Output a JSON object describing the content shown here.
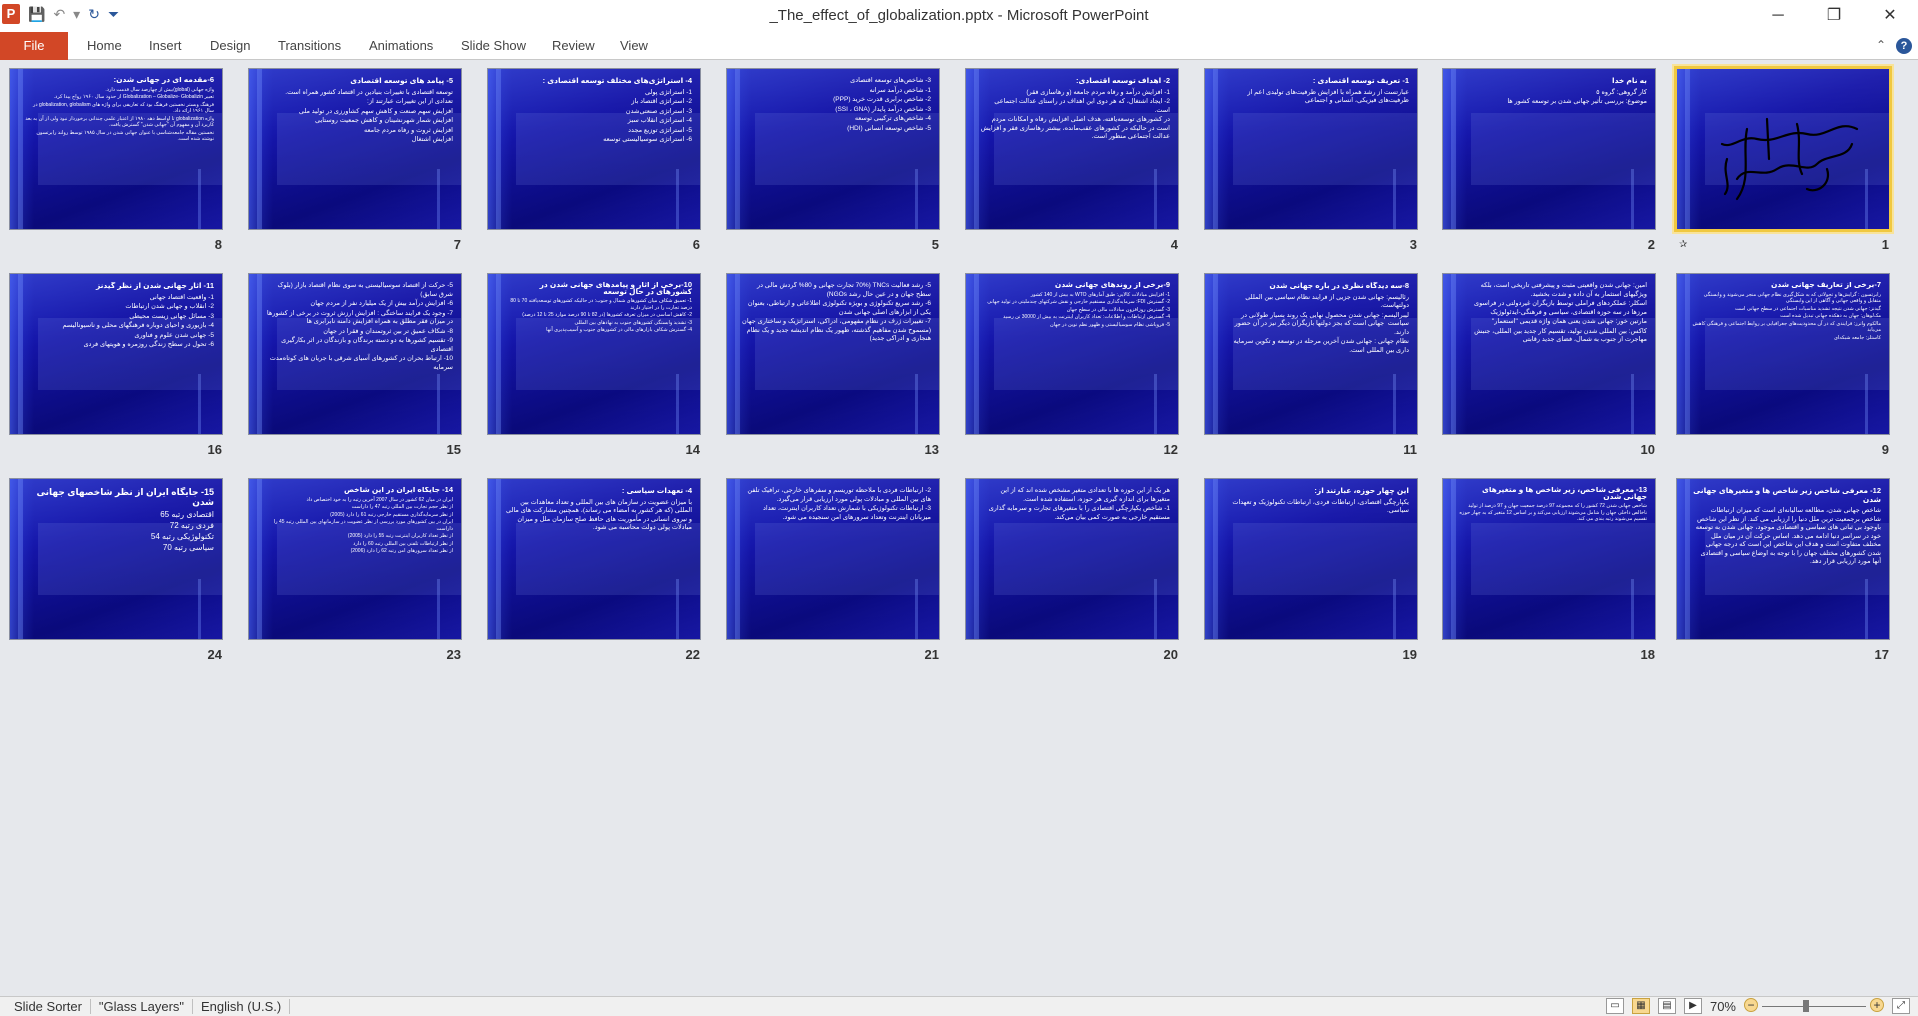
{
  "window": {
    "title": "_The_effect_of_globalization.pptx - Microsoft PowerPoint",
    "app_icon_letter": "P",
    "minimize_glyph": "─",
    "maximize_glyph": "❐",
    "close_glyph": "✕"
  },
  "qat": {
    "save_icon": "💾",
    "undo_icon": "↶",
    "undo_dropdown": "▾",
    "redo_icon": "↻",
    "customize_icon": "⏷"
  },
  "ribbon": {
    "file_label": "File",
    "tabs": [
      "Home",
      "Insert",
      "Design",
      "Transitions",
      "Animations",
      "Slide Show",
      "Review",
      "View"
    ],
    "minimize_ribbon_icon": "⌃",
    "help_icon": "?"
  },
  "slides": [
    {
      "number": "1",
      "selected": true,
      "calligraphy": true,
      "lines": []
    },
    {
      "number": "2",
      "title": "به نام خدا",
      "lines": [
        "کار گروهی: گروه ٥",
        "موضوع: بررسی تأثیر جهانی شدن بر توسعه کشور ها"
      ]
    },
    {
      "number": "3",
      "title": "1- تعریف توسعه اقتصادی :",
      "lines": [
        "عبارتست از رشد همراه با افزایش ظرفیت‌های تولیدی اعم از ظرفیت‌های فیزیکی، انسانی و اجتماعی"
      ]
    },
    {
      "number": "4",
      "title": "2- اهداف توسعه اقتصادی:",
      "lines": [
        "1- افزایش درآمد و رفاه مردم جامعه (و رهاسازی فقر)",
        "2- ایجاد اشتغال، که هر دوی این اهداف در راستای عدالت اجتماعی است.",
        "در کشورهای توسعه‌یافته، هدف اصلی افزایش رفاه و امکانات مردم است در حالیکه در کشورهای عقب‌مانده، بیشتر رهاسازی فقر و افزایش عدالت اجتماعی منظور است."
      ]
    },
    {
      "number": "5",
      "title": "",
      "lines": [
        "3- شاخص‌های توسعه اقتصادی",
        "1- شاخص درآمد سرانه",
        "2- شاخص برابری قدرت خرید (PPP)",
        "3- شاخص درآمد پایدار (SSI ، GNA)",
        "4- شاخص‌های ترکیبی توسعه",
        "5- شاخص توسعه انسانی (HDI)"
      ]
    },
    {
      "number": "6",
      "title": "4- استراتژی‌های مختلف توسعه اقتصادی :",
      "lines": [
        "1- استراتژی پولی",
        "2- استراتژی اقتصاد باز",
        "3- استراتژی صنعتی‌شدن",
        "4- استراتژی انقلاب سبز",
        "5- استراتژی توزیع مجدد",
        "6- استراتژی سوسیالیستی توسعه"
      ]
    },
    {
      "number": "7",
      "title": "5- پیامد های توسعه اقتصادی",
      "lines": [
        "توسعه اقتصادی با تغییرات بنیادین در اقتصاد کشور همراه است.",
        "تعدادی از این تغییرات عبارتند از:",
        "افزایش سهم صنعت و کاهش سهم کشاورزی در تولید ملی",
        "افزایش شمار شهرنشینان و کاهش جمعیت روستایی",
        "افزایش ثروت و رفاه مردم جامعه",
        "افزایش اشتغال"
      ]
    },
    {
      "number": "8",
      "title": "6-مقدمه ای در جهانی شدن:",
      "tiny": true,
      "lines": [
        "واژه جهانی (global)بیش از چهارصد سال قدمت دارد.",
        "تعبیر Globalization – Globalize- Globalizin از حدود سال ۱۹۶۰ رواج پیدا کرد.",
        "فرهنگ وبستر نخستین فرهنگ بود که تعاریفی برای واژه های globalization, globalism در سال ۱۹۶۱ ارائه داد.",
        "واژه globalization تا اواسط دهه ۱۹۸۰ از اعتبار علمی چندانی برخوردار نبود ولی از آن به بعد کاربرد آن و مفهوم آن \"جهانی شدن\" گسترش یافت.",
        "نخستین مقاله جامعه‌شناسی با عنوان جهانی شدن در سال ۱۹۸۵ توسط رولند رابرتسون نوشته شده است."
      ]
    },
    {
      "number": "9",
      "title": "7-برخی از تعاریف جهانی شدن",
      "tiny": true,
      "lines": [
        "رابرتسون : گرایش‌ها و تحولاتی که به شکل‌گیری نظام جهانی منجر می‌شوند و وابستگی متقابل و واقعی جهانی و آگاهی از این وابستگی",
        "گیدنز: جهانی شدن نتیجه تشدید مناسبات اجتماعی در سطح جهانی است",
        "مک‌لوهان: جهان به دهکده جهانی تبدیل شده است",
        "مالکوم واترز: فرایندی که در آن محدودیت‌های جغرافیایی بر روابط اجتماعی و فرهنگی کاهش می‌یابد",
        "کاستلز: جامعه شبکه‌ای"
      ]
    },
    {
      "number": "10",
      "title": "",
      "lines": [
        "امین: جهانی شدن واقعیتی مثبت و پیشرفتی تاریخی است، بلکه ویژگیهای استثمار به آن داده و شدت بخشید.",
        "اسکلر: عملکردهای فراملی توسط بازیگران غیردولتی در فراسوی مرزها در سه حوزه اقتصادی، سیاسی و فرهنگی-ایدئولوژیک",
        "مارتین خور: جهانی شدن یعنی همان واژه قدیمی \"استعمار\"",
        "کاکس: بین المللی شدن تولید، تقسیم کار جدید بین المللی، جنبش مهاجرت از جنوب به شمال، فضای جدید رقابتی"
      ]
    },
    {
      "number": "11",
      "title": "8-سه دیدگاه نظری در باره جهانی شدن",
      "lines": [
        "رئالیسم: جهانی شدن جزیی از فرایند نظام سیاسی بین المللی دولتهاست.",
        "لیبرالیسم: جهانی شدن محصول نهایی یک روند بسیار طولانی در سیاست ‌ جهانی است که بجز دولتها بازیگران دیگر نیز در آن حضور دارند.",
        "نظام جهانی : جهانی شدن آخرین مرحله در توسعه و تکوین سرمایه داری بین المللی است."
      ]
    },
    {
      "number": "12",
      "title": "9-برخی از روندهای جهانی شدن",
      "tiny": true,
      "lines": [
        "1- افزایش مبادلات کالایی: طبق آمارهای WTO به بیش از 140 کشور",
        "2- گسترش FDI: سرمایه‌گذاری مستقیم خارجی و نقش شرکتهای چندملیتی در تولید جهانی",
        "3- گسترش روزافزون مبادلات مالی در سطح جهان",
        "4- گسترش ارتباطات و اطلاعات: تعداد کاربران اینترنت به بیش از 30000 تن رسید",
        "5- فروپاشی نظام سوسیالیستی و ظهور نظم نوین در جهان"
      ]
    },
    {
      "number": "13",
      "title": "",
      "lines": [
        "5- رشد فعالیت TNCs (70% تجارت جهانی و 80% گردش مالی در سطح جهان و در عین حال رشد NGOs)",
        "6- رشد سریع تکنولوژی و بویژه تکنولوژی اطلاعاتی و ارتباطی، بعنوان یکی از ابزارهای اصلی جهانی شدن",
        "7- تغییرات ژرف در نظام مفهومی، ادراکی، استراتژیک و ساختاری جهان (مسموح شدن مفاهیم گذشته، ظهور یک نظام اندیشه جدید و یک نظام هنجاری و ادراکی جدید)"
      ]
    },
    {
      "number": "14",
      "title": "10-برخی از آثار و پیامدهای جهانی شدن در کشورهای در حال توسعه",
      "tiny": true,
      "lines": [
        "1- تعمیق شکاف میان کشورهای شمال و جنوب: در حالیکه کشورهای توسعه‌یافته 70 تا 80 درصد تجارت را در اختیار دارند",
        "2- کاهش اساسی در میزان تعرفه کشورها (در 82 تا 90 درصد موارد 25 تا 12 درصد)",
        "3- تشدید وابستگی کشورهای جنوب به نهادهای بین المللی",
        "4- گسترش شکاف بازارهای مالی در کشورهای جنوب و آسیب‌پذیری آنها"
      ]
    },
    {
      "number": "15",
      "title": "",
      "lines": [
        "5- حرکت از اقتصاد سوسیالیستی به سوی نظام اقتصاد بازار (بلوک شرق سابق)",
        "6- افزایش درآمد بیش از یک میلیارد نفر از مردم جهان",
        "7- وجود یک فرایند ساختگی : افزایش ارزش ثروت در برخی از کشورها در میزان فقر مطلق به همراه افزایش دامنه نابرابری ها",
        "8- شکاف عمیق تر بین ثروتمندان و فقرا در جهان",
        "9- تقسیم کشورها به دو دسته برندگان و بازندگان در اثر بکارگیری اقتصادی",
        "10- ارتباط بحران در کشورهای آسیای شرقی با جریان های کوتاه‌مدت سرمایه"
      ]
    },
    {
      "number": "16",
      "title": "11- آثار جهانی شدن از نظر گیدنز",
      "lines": [
        "1- واقعیت اقتصاد جهانی",
        "2- انقلاب و جهانی شدن ارتباطات",
        "3- مسائل جهانی زیست محیطی",
        "4- بازیوری و احیای دوباره فرهنگهای محلی و ناسیونالیسم",
        "5- جهانی شدن علوم و فناوری",
        "6- تحول در سطح زندگی روزمره و هویتهای فردی"
      ]
    },
    {
      "number": "17",
      "title": "12- معرفی شاخص زیر شاخص ها و متغیرهای جهانی شدن",
      "lines": [
        "شاخص جهانی شدن، مطالعه سالیانه‌ای است که میزان ارتباطات شاخص برجمعیت ترین ملل دنیا را ارزیابی می کند. از نظر این شاخص باوجود بی ثباتی های سیاسی و اقتصادی موجود، جهانی شدن به توسعه خود در سراسر دنیا ادامه می دهد. اساس حرکت آن در میان ملل مختلف متفاوت است و هدف این شاخص این است که درجه جهانی شدن کشورهای مختلف جهان را با توجه به اوضاع سیاسی و اقتصادی آنها مورد ارزیابی قرار دهد."
      ]
    },
    {
      "number": "18",
      "title": "13- معرفی شاخص، زیر شاخص ها و متغیرهای جهانی شدن",
      "tiny": true,
      "lines": [
        "شاخص جهانی شدن 72 کشور را که مجموعه 97 درصد جمعیت جهان و 97 درصد از تولید ناخالص داخلی جهان را شامل می‌شوند ارزیابی می‌کند و بر اساس 12 متغیر که به چهار حوزه تقسیم می‌شوند رتبه بندی می کند."
      ]
    },
    {
      "number": "19",
      "title": "این چهار حوزه، عبارتند از:",
      "lines": [
        "یکپارچگی اقتصادی، ارتباطات فردی، ارتباطات تکنولوژیک و تعهدات سیاسی."
      ]
    },
    {
      "number": "20",
      "title": "",
      "lines": [
        "هر یک از این حوزه ها با تعدادی متغیر مشخص شده اند که از این متغیرها برای اندازه گیری هر حوزه، استفاده شده است.",
        "1- شاخص یکپارچگی اقتصادی را با متغیرهای تجارت و سرمایه گذاری مستقیم خارجی به صورت کمی بیان می‌کند."
      ]
    },
    {
      "number": "21",
      "title": "",
      "lines": [
        "2- ارتباطات فردی با ملاحظه توریسم و سفرهای خارجی، ترافیک تلفن های بین المللی و مبادلات پولی مورد ارزیابی قرار می‌گیرد.",
        "3- ارتباطات تکنولوژیکی با شمارش تعداد کاربران اینترنت، تعداد میزبانان اینترنت وتعداد سرورهای امن سنجیده می شود."
      ]
    },
    {
      "number": "22",
      "title": "4- تعهدات سیاسی :",
      "lines": [
        "با میزان عضویت در سازمان های بین المللی و تعداد معاهدات بین المللی (که هر کشور به امضاء می رساند)، همچنین مشارکت های مالی و نیروی انسانی در مأموریت های حافظ صلح سازمان ملل و میزان مبادلات پولی دولت محاسبه می شود."
      ]
    },
    {
      "number": "23",
      "title": "14- جایگاه ایران در این شاخص",
      "tiny": true,
      "lines": [
        "ایران در میان 62 کشور در سال 2007 آخرین رتبه را به خود اختصاص داد",
        "از نظر حجم تجارت بین المللی رتبه 47 را داراست",
        "از نظر سرمایه‌گذاری مستقیم خارجی رتبه 61 را دارد (2005)",
        "ایران در بین کشورهای مورد بررسی از نظر عضویت در سازمانهای بین المللی رتبه 45 را داراست",
        "از نظر تعداد کاربران اینترنت رتبه 55 را دارد (2005)",
        "از نظر ارتباطات تلفنی بین المللی رتبه 60 را دارد",
        "از نظر تعداد سرورهای امن رتبه 62 را دارد (2006)"
      ]
    },
    {
      "number": "24",
      "title": "15- جایگاه ایران از نظر شاخصهای جهانی شدن",
      "big": true,
      "lines": [
        "اقتصادی رتبه 65",
        "فردی رتبه 72",
        "تکنولوژیکی رتبه 54",
        "سیاسی رتبه 70"
      ]
    }
  ],
  "statusbar": {
    "view_name": "Slide Sorter",
    "theme_name": "\"Glass Layers\"",
    "language": "English (U.S.)",
    "zoom_level": "70%",
    "zoom_fraction": 0.42,
    "normal_view_icon": "▭",
    "sorter_view_icon": "▦",
    "reading_view_icon": "▤",
    "slideshow_view_icon": "▶",
    "fit_icon": "⤢",
    "zoom_out": "−",
    "zoom_in": "+"
  },
  "colors": {
    "file_tab": "#d24726",
    "slide_bg": "#1414a8",
    "selected_border": "#f0c840"
  }
}
